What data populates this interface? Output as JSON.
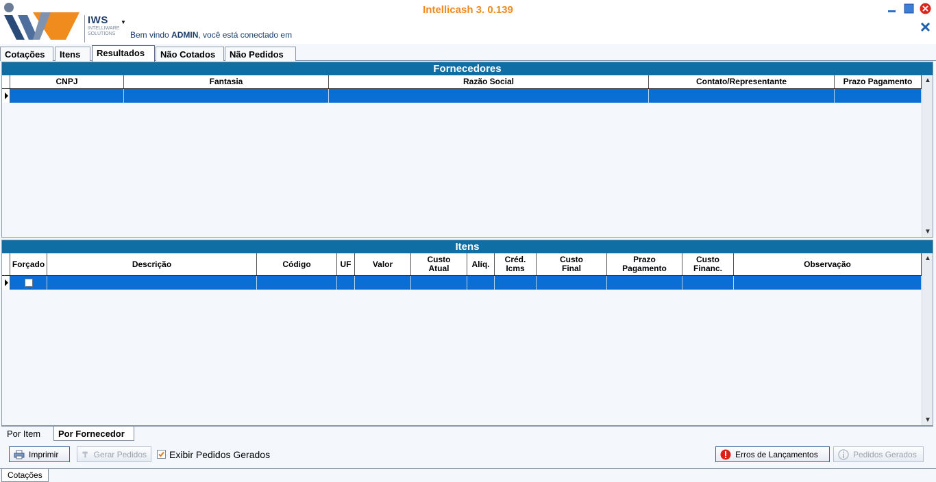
{
  "header": {
    "logo_text": "IWS",
    "logo_sub": "INTELLIWARE SOLUTIONS",
    "welcome_prefix": "Bem vindo ",
    "welcome_user": "ADMIN",
    "welcome_suffix": ", você está conectado em",
    "app_title": "Intellicash 3. 0.139"
  },
  "tabs": [
    "Cotações",
    "Itens",
    "Resultados",
    "Não Cotados",
    "Não Pedidos"
  ],
  "fornecedores": {
    "title": "Fornecedores",
    "columns": [
      "CNPJ",
      "Fantasia",
      "Razão Social",
      "Contato/Representante",
      "Prazo Pagamento"
    ]
  },
  "itens": {
    "title": "Itens",
    "columns": [
      "Forçado",
      "Descrição",
      "Código",
      "UF",
      "Valor",
      "Custo\nAtual",
      "Alíq.",
      "Créd.\nIcms",
      "Custo\nFinal",
      "Prazo\nPagamento",
      "Custo\nFinanc.",
      "Observação"
    ]
  },
  "bottom_tabs": [
    "Por Item",
    "Por Fornecedor"
  ],
  "actions": {
    "imprimir": "Imprimir",
    "gerar_pedidos": "Gerar Pedidos",
    "exibir_label": "Exibir Pedidos Gerados",
    "erros": "Erros de Lançamentos",
    "pedidos_gerados": "Pedidos Gerados"
  },
  "status_tab": "Cotações",
  "colors": {
    "accent": "#0f6ea3",
    "selection": "#0a6fd4",
    "title_orange": "#f0891e"
  }
}
